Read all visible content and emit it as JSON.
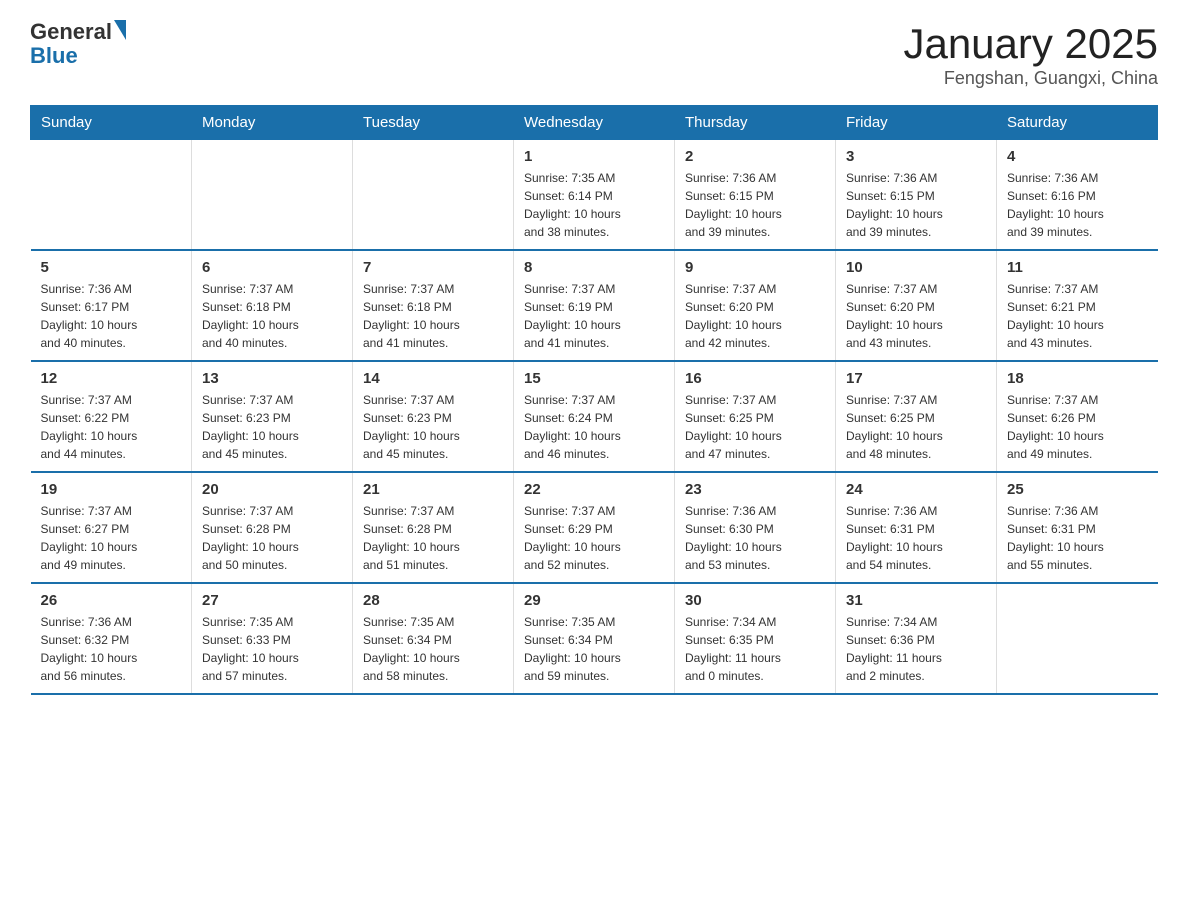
{
  "header": {
    "logo_text_general": "General",
    "logo_text_blue": "Blue",
    "month_title": "January 2025",
    "location": "Fengshan, Guangxi, China"
  },
  "days_of_week": [
    "Sunday",
    "Monday",
    "Tuesday",
    "Wednesday",
    "Thursday",
    "Friday",
    "Saturday"
  ],
  "weeks": [
    [
      {
        "day": "",
        "info": ""
      },
      {
        "day": "",
        "info": ""
      },
      {
        "day": "",
        "info": ""
      },
      {
        "day": "1",
        "info": "Sunrise: 7:35 AM\nSunset: 6:14 PM\nDaylight: 10 hours\nand 38 minutes."
      },
      {
        "day": "2",
        "info": "Sunrise: 7:36 AM\nSunset: 6:15 PM\nDaylight: 10 hours\nand 39 minutes."
      },
      {
        "day": "3",
        "info": "Sunrise: 7:36 AM\nSunset: 6:15 PM\nDaylight: 10 hours\nand 39 minutes."
      },
      {
        "day": "4",
        "info": "Sunrise: 7:36 AM\nSunset: 6:16 PM\nDaylight: 10 hours\nand 39 minutes."
      }
    ],
    [
      {
        "day": "5",
        "info": "Sunrise: 7:36 AM\nSunset: 6:17 PM\nDaylight: 10 hours\nand 40 minutes."
      },
      {
        "day": "6",
        "info": "Sunrise: 7:37 AM\nSunset: 6:18 PM\nDaylight: 10 hours\nand 40 minutes."
      },
      {
        "day": "7",
        "info": "Sunrise: 7:37 AM\nSunset: 6:18 PM\nDaylight: 10 hours\nand 41 minutes."
      },
      {
        "day": "8",
        "info": "Sunrise: 7:37 AM\nSunset: 6:19 PM\nDaylight: 10 hours\nand 41 minutes."
      },
      {
        "day": "9",
        "info": "Sunrise: 7:37 AM\nSunset: 6:20 PM\nDaylight: 10 hours\nand 42 minutes."
      },
      {
        "day": "10",
        "info": "Sunrise: 7:37 AM\nSunset: 6:20 PM\nDaylight: 10 hours\nand 43 minutes."
      },
      {
        "day": "11",
        "info": "Sunrise: 7:37 AM\nSunset: 6:21 PM\nDaylight: 10 hours\nand 43 minutes."
      }
    ],
    [
      {
        "day": "12",
        "info": "Sunrise: 7:37 AM\nSunset: 6:22 PM\nDaylight: 10 hours\nand 44 minutes."
      },
      {
        "day": "13",
        "info": "Sunrise: 7:37 AM\nSunset: 6:23 PM\nDaylight: 10 hours\nand 45 minutes."
      },
      {
        "day": "14",
        "info": "Sunrise: 7:37 AM\nSunset: 6:23 PM\nDaylight: 10 hours\nand 45 minutes."
      },
      {
        "day": "15",
        "info": "Sunrise: 7:37 AM\nSunset: 6:24 PM\nDaylight: 10 hours\nand 46 minutes."
      },
      {
        "day": "16",
        "info": "Sunrise: 7:37 AM\nSunset: 6:25 PM\nDaylight: 10 hours\nand 47 minutes."
      },
      {
        "day": "17",
        "info": "Sunrise: 7:37 AM\nSunset: 6:25 PM\nDaylight: 10 hours\nand 48 minutes."
      },
      {
        "day": "18",
        "info": "Sunrise: 7:37 AM\nSunset: 6:26 PM\nDaylight: 10 hours\nand 49 minutes."
      }
    ],
    [
      {
        "day": "19",
        "info": "Sunrise: 7:37 AM\nSunset: 6:27 PM\nDaylight: 10 hours\nand 49 minutes."
      },
      {
        "day": "20",
        "info": "Sunrise: 7:37 AM\nSunset: 6:28 PM\nDaylight: 10 hours\nand 50 minutes."
      },
      {
        "day": "21",
        "info": "Sunrise: 7:37 AM\nSunset: 6:28 PM\nDaylight: 10 hours\nand 51 minutes."
      },
      {
        "day": "22",
        "info": "Sunrise: 7:37 AM\nSunset: 6:29 PM\nDaylight: 10 hours\nand 52 minutes."
      },
      {
        "day": "23",
        "info": "Sunrise: 7:36 AM\nSunset: 6:30 PM\nDaylight: 10 hours\nand 53 minutes."
      },
      {
        "day": "24",
        "info": "Sunrise: 7:36 AM\nSunset: 6:31 PM\nDaylight: 10 hours\nand 54 minutes."
      },
      {
        "day": "25",
        "info": "Sunrise: 7:36 AM\nSunset: 6:31 PM\nDaylight: 10 hours\nand 55 minutes."
      }
    ],
    [
      {
        "day": "26",
        "info": "Sunrise: 7:36 AM\nSunset: 6:32 PM\nDaylight: 10 hours\nand 56 minutes."
      },
      {
        "day": "27",
        "info": "Sunrise: 7:35 AM\nSunset: 6:33 PM\nDaylight: 10 hours\nand 57 minutes."
      },
      {
        "day": "28",
        "info": "Sunrise: 7:35 AM\nSunset: 6:34 PM\nDaylight: 10 hours\nand 58 minutes."
      },
      {
        "day": "29",
        "info": "Sunrise: 7:35 AM\nSunset: 6:34 PM\nDaylight: 10 hours\nand 59 minutes."
      },
      {
        "day": "30",
        "info": "Sunrise: 7:34 AM\nSunset: 6:35 PM\nDaylight: 11 hours\nand 0 minutes."
      },
      {
        "day": "31",
        "info": "Sunrise: 7:34 AM\nSunset: 6:36 PM\nDaylight: 11 hours\nand 2 minutes."
      },
      {
        "day": "",
        "info": ""
      }
    ]
  ]
}
